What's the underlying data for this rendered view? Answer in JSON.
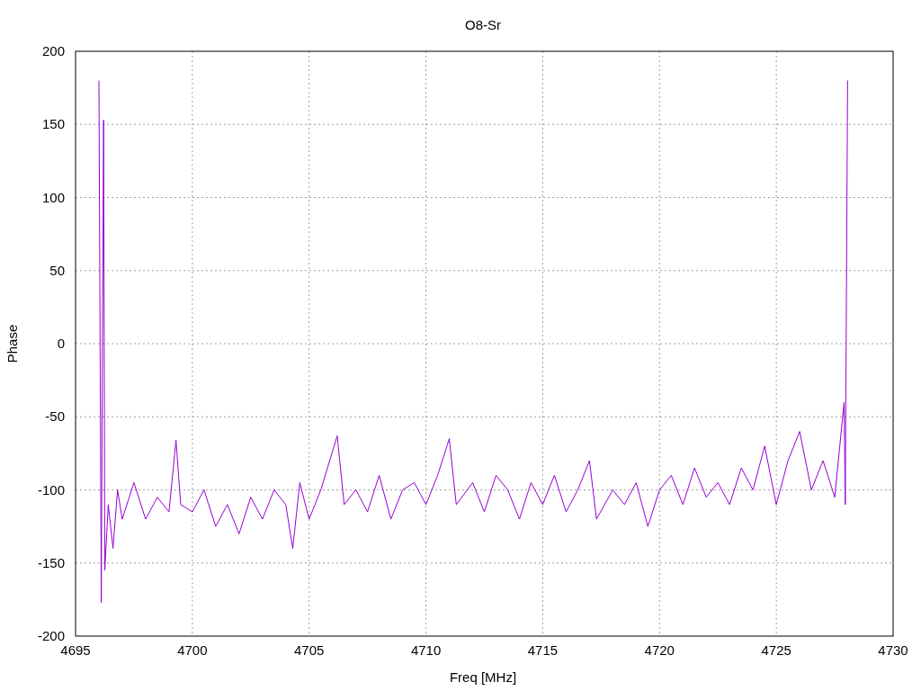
{
  "chart_data": {
    "type": "line",
    "title": "O8-Sr",
    "xlabel": "Freq [MHz]",
    "ylabel": "Phase",
    "xlim": [
      4695,
      4730
    ],
    "ylim": [
      -200,
      200
    ],
    "xticks": [
      4695,
      4700,
      4705,
      4710,
      4715,
      4720,
      4725,
      4730
    ],
    "yticks": [
      -200,
      -150,
      -100,
      -50,
      0,
      50,
      100,
      150,
      200
    ],
    "x": [
      4696.0,
      4696.05,
      4696.1,
      4696.15,
      4696.2,
      4696.25,
      4696.4,
      4696.6,
      4696.8,
      4697,
      4697.5,
      4698,
      4698.5,
      4699,
      4699.3,
      4699.5,
      4700,
      4700.5,
      4701,
      4701.5,
      4702,
      4702.5,
      4703,
      4703.5,
      4704,
      4704.3,
      4704.6,
      4705,
      4705.5,
      4706.2,
      4706.5,
      4707,
      4707.5,
      4708,
      4708.5,
      4709,
      4709.5,
      4710,
      4710.5,
      4711,
      4711.3,
      4712,
      4712.5,
      4713,
      4713.5,
      4714,
      4714.5,
      4715,
      4715.5,
      4716,
      4716.5,
      4717,
      4717.3,
      4718,
      4718.5,
      4719,
      4719.5,
      4720,
      4720.5,
      4721,
      4721.5,
      4722,
      4722.5,
      4723,
      4723.5,
      4724,
      4724.5,
      4725,
      4725.5,
      4726,
      4726.5,
      4727,
      4727.5,
      4727.9,
      4727.95,
      4728.0,
      4728.05
    ],
    "grid": true,
    "series": [
      {
        "color": "#9400d3",
        "values": [
          180,
          0,
          -177,
          7,
          153,
          -155,
          -110,
          -140,
          -100,
          -120,
          -95,
          -120,
          -105,
          -115,
          -66,
          -110,
          -115,
          -100,
          -125,
          -110,
          -130,
          -105,
          -120,
          -100,
          -110,
          -140,
          -95,
          -120,
          -100,
          -63,
          -110,
          -100,
          -115,
          -90,
          -120,
          -100,
          -95,
          -110,
          -90,
          -65,
          -110,
          -95,
          -115,
          -90,
          -100,
          -120,
          -95,
          -110,
          -90,
          -115,
          -100,
          -80,
          -120,
          -100,
          -110,
          -95,
          -125,
          -100,
          -90,
          -110,
          -85,
          -105,
          -95,
          -110,
          -85,
          -100,
          -70,
          -110,
          -80,
          -60,
          -100,
          -80,
          -105,
          -40,
          -110,
          35,
          180
        ]
      }
    ]
  }
}
